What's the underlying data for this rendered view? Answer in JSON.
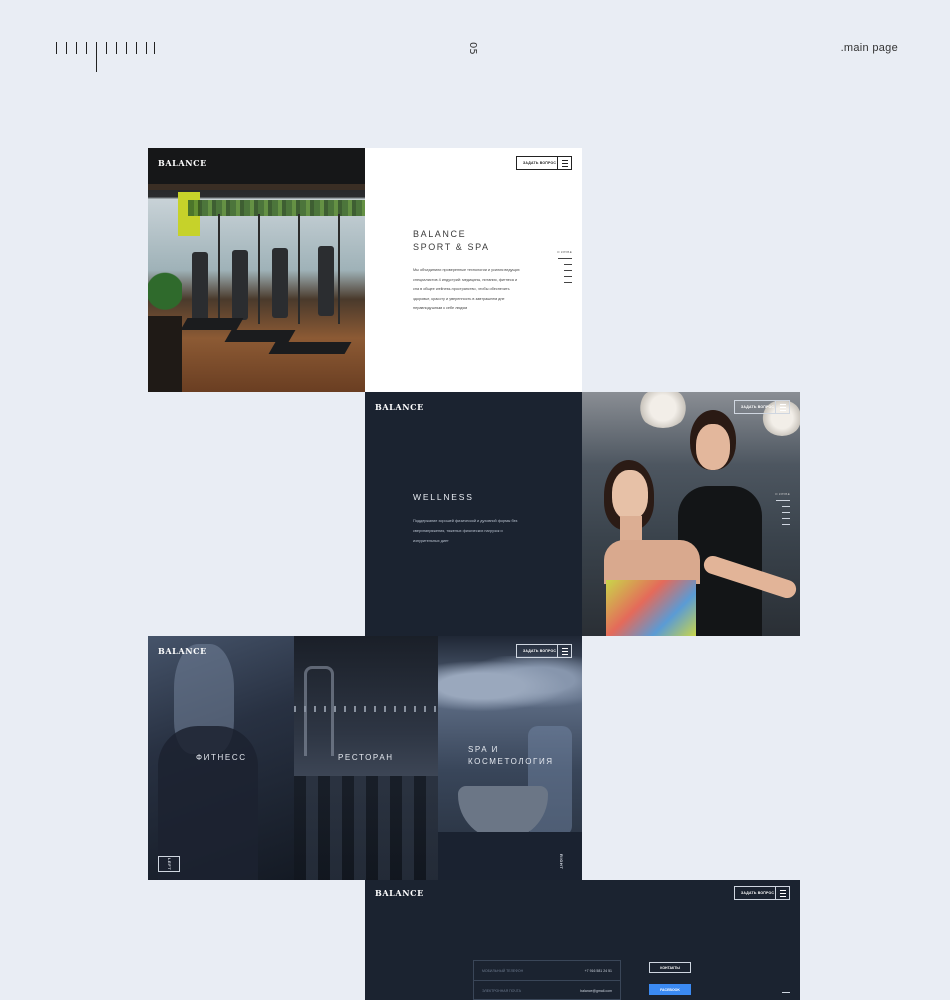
{
  "header": {
    "page_number": "05",
    "page_label": ".main page"
  },
  "brand": "BALANCE",
  "hero": {
    "title_line1": "BALANCE",
    "title_line2": "SPORT & SPA",
    "text": "Мы объединили проверенные технологии и усилия ведущих специалистов 4 индустрий: медицины, питания, фитнеса и спа в общее wellness-пространство, чтобы обеспечить здоровье, красоту и уверенность в завтрашнем дне неравнодушным к себе людям",
    "ask_button": "ЗАДАТЬ ВОПРОС",
    "nav_label": "О КЛУБЕ"
  },
  "wellness": {
    "title": "WELLNESS",
    "text": "Поддержание хорошей физической и духовной формы без сверхнапряжения, тяжелых физических нагрузок и изнурительных диет",
    "ask_button": "ЗАДАТЬ ВОПРОС",
    "nav_label": "О КЛУБЕ"
  },
  "collage": {
    "fitness": "ФИТНЕСС",
    "restaurant": "РЕСТОРАН",
    "spa_line1": "SPA И",
    "spa_line2": "КОСМЕТОЛОГИЯ",
    "left": "LEFT",
    "right": "RIGHT",
    "ask_button": "ЗАДАТЬ ВОПРОС"
  },
  "contact": {
    "ask_button": "ЗАДАТЬ ВОПРОС",
    "phone_label": "МОБИЛЬНЫЙ ТЕЛЕФОН",
    "phone_value": "+7 916 581 24 51",
    "email_label": "ЭЛЕКТРОННАЯ ПОЧТА",
    "email_value": "balance@gmail.com",
    "btn_contacts": "КОНТАКТЫ",
    "btn_facebook": "FACEBOOK"
  }
}
